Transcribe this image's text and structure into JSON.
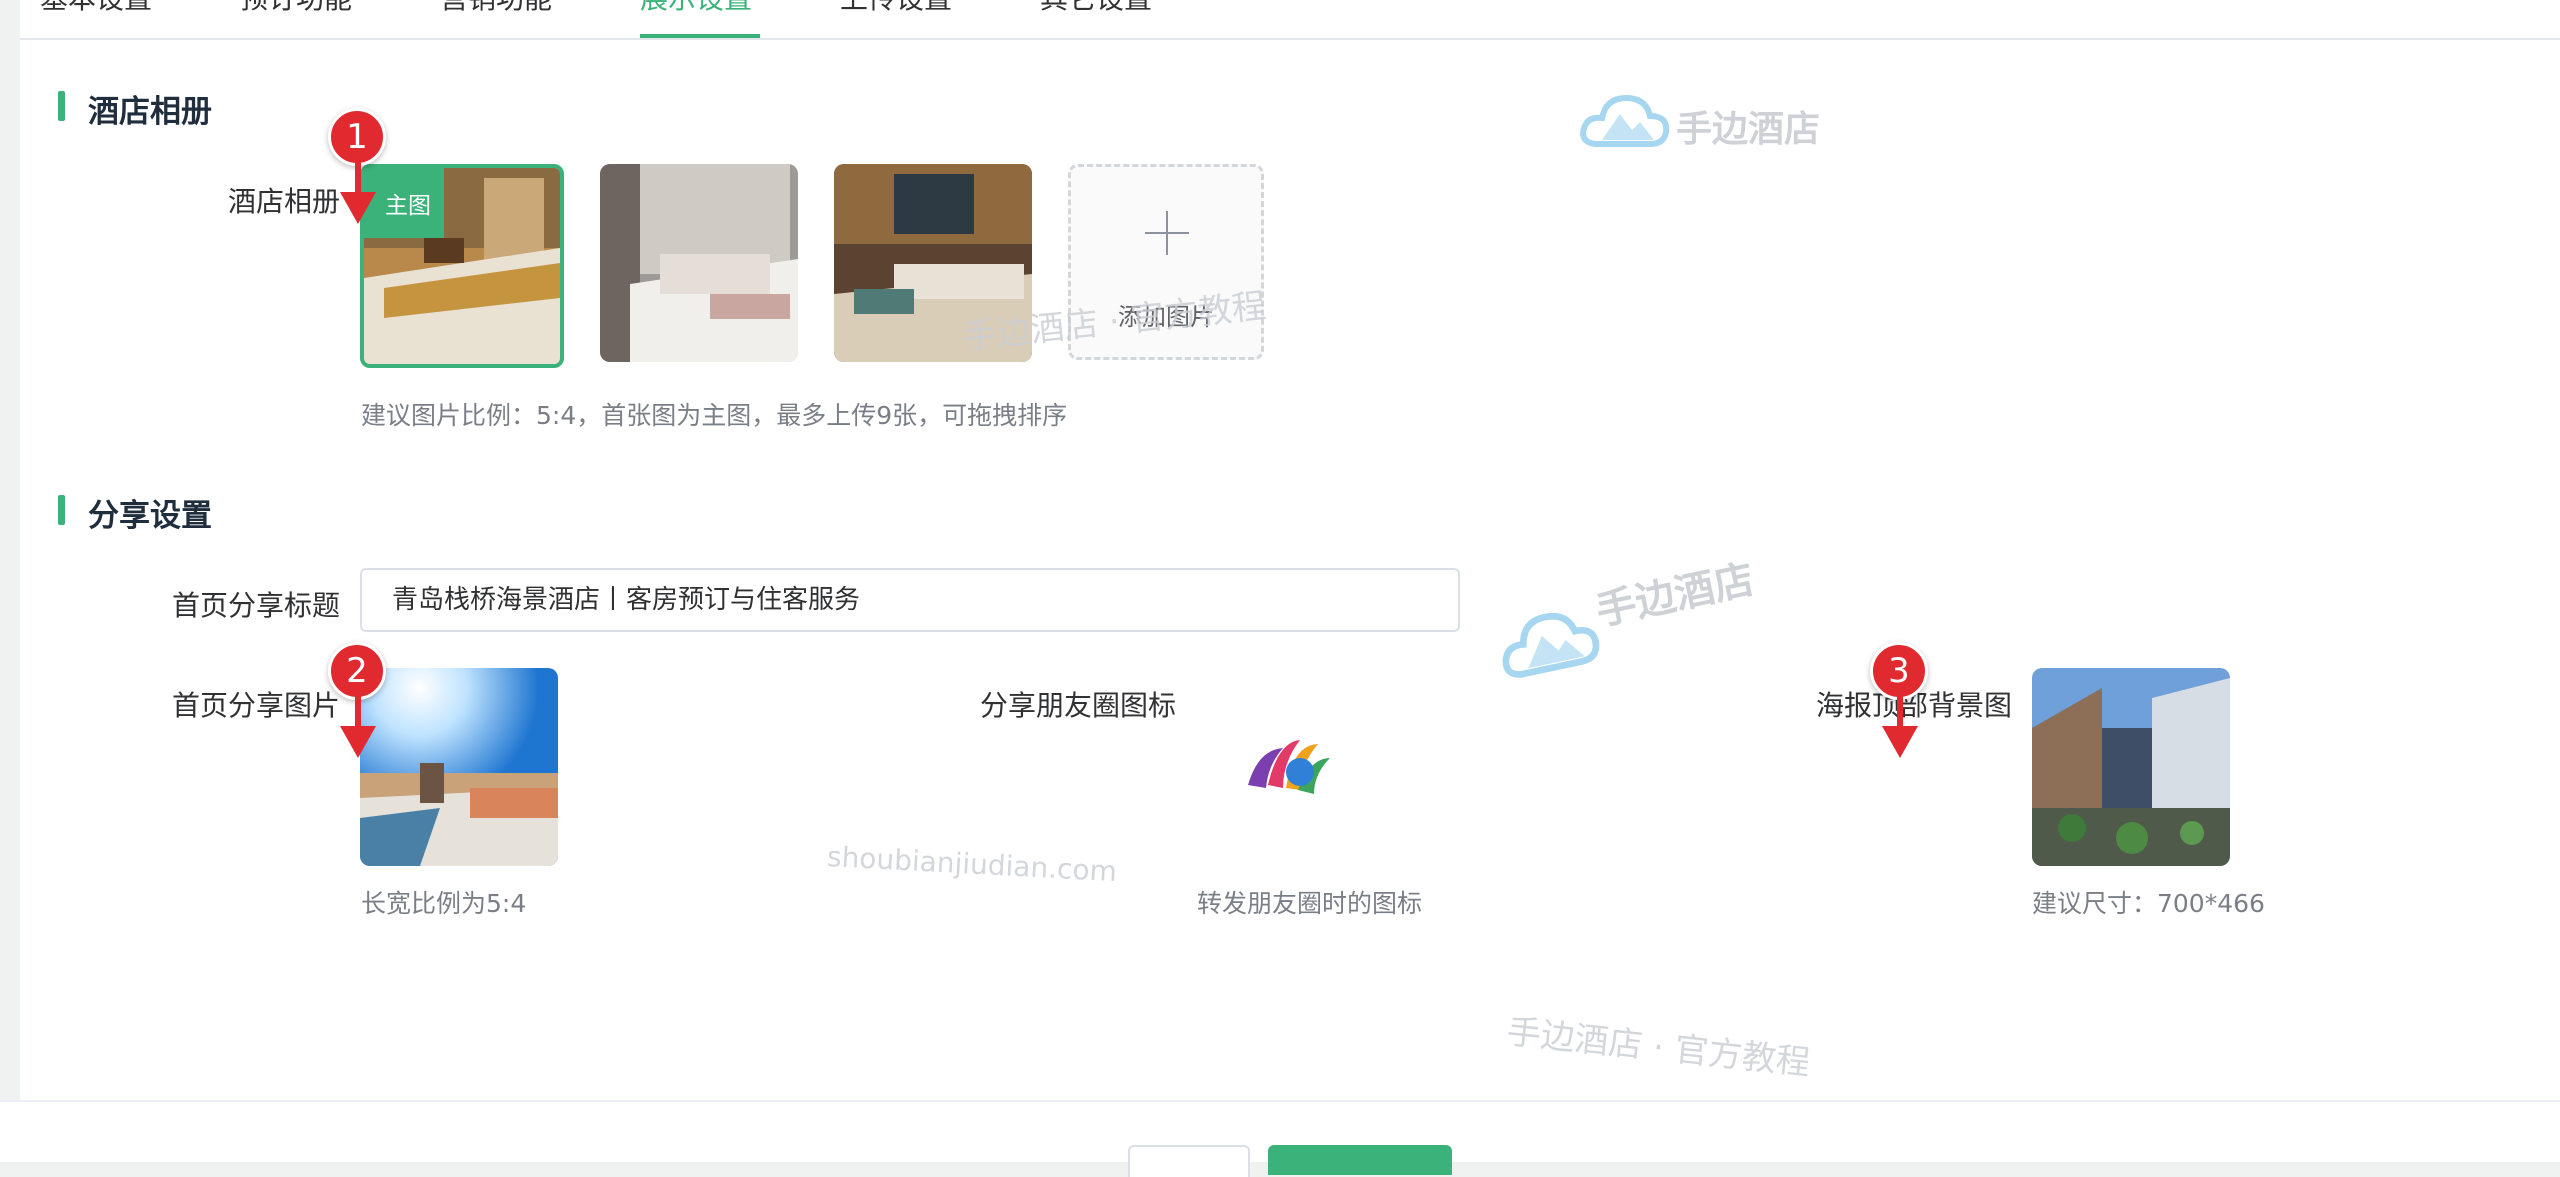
{
  "tabs": {
    "items": [
      {
        "label": "基本设置"
      },
      {
        "label": "预订功能"
      },
      {
        "label": "营销功能"
      },
      {
        "label": "展示设置"
      },
      {
        "label": "上传设置"
      },
      {
        "label": "其它设置"
      }
    ],
    "active_index": 3
  },
  "album": {
    "section_title": "酒店相册",
    "field_label": "酒店相册",
    "main_tag": "主图",
    "add_label": "添加图片",
    "hint": "建议图片比例：5:4，首张图为主图，最多上传9张，可拖拽排序"
  },
  "share": {
    "section_title": "分享设置",
    "title_label": "首页分享标题",
    "title_value": "青岛栈桥海景酒店丨客房预订与住客服务",
    "image_label": "首页分享图片",
    "image_hint": "长宽比例为5:4",
    "moments_label": "分享朋友圈图标",
    "moments_hint": "转发朋友圈时的图标",
    "poster_label": "海报顶部背景图",
    "poster_hint": "建议尺寸：700*466"
  },
  "badges": [
    "1",
    "2",
    "3"
  ],
  "watermarks": {
    "brand": "手边酒店",
    "tagline": "手边酒店 · 官方教程",
    "domain": "shoubianjiudian.com"
  },
  "colors": {
    "accent": "#3bb27a",
    "badge": "#e02a2f"
  },
  "icons": {
    "add": "plus-icon",
    "moments": "colorful-moments-logo-icon",
    "annotation": "red-arrow-icon"
  }
}
